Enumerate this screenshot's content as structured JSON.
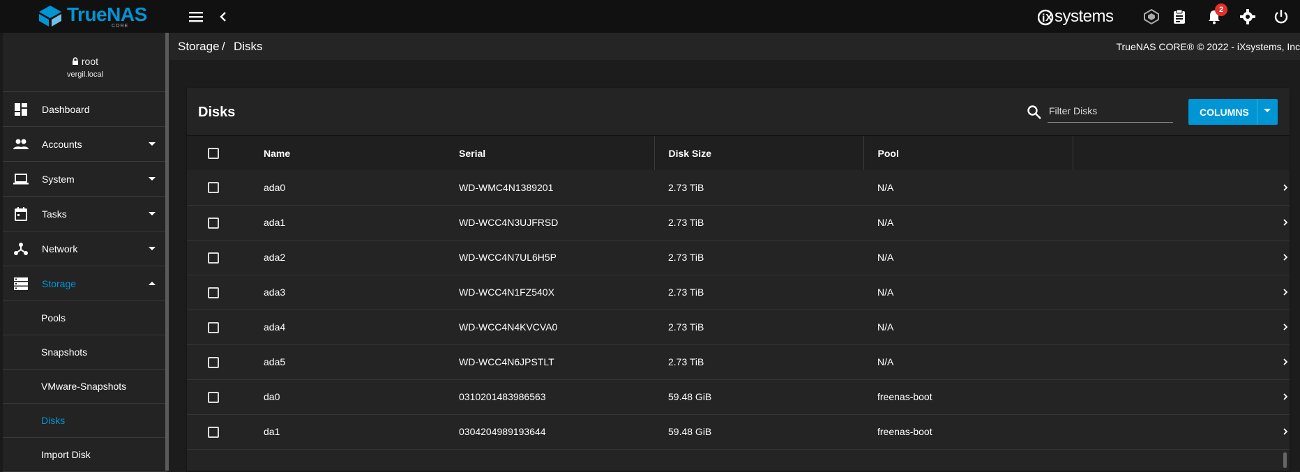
{
  "app": {
    "logo_name": "TrueNAS",
    "logo_sub": "CORE",
    "vendor": "systems",
    "notification_count": "2"
  },
  "user": {
    "name": "root",
    "host": "vergil.local"
  },
  "sidebar": {
    "items": [
      {
        "label": "Dashboard"
      },
      {
        "label": "Accounts"
      },
      {
        "label": "System"
      },
      {
        "label": "Tasks"
      },
      {
        "label": "Network"
      },
      {
        "label": "Storage"
      }
    ],
    "storage_sub": [
      {
        "label": "Pools"
      },
      {
        "label": "Snapshots"
      },
      {
        "label": "VMware-Snapshots"
      },
      {
        "label": "Disks"
      },
      {
        "label": "Import Disk"
      }
    ]
  },
  "breadcrumb": {
    "parent": "Storage",
    "separator": "/",
    "current": "Disks"
  },
  "copyright": "TrueNAS CORE® © 2022 - iXsystems, Inc.",
  "card": {
    "title": "Disks",
    "filter_placeholder": "Filter Disks",
    "columns_label": "COLUMNS"
  },
  "table": {
    "headers": [
      "Name",
      "Serial",
      "Disk Size",
      "Pool"
    ],
    "rows": [
      {
        "name": "ada0",
        "serial": "WD-WMC4N1389201",
        "size": "2.73 TiB",
        "pool": "N/A"
      },
      {
        "name": "ada1",
        "serial": "WD-WCC4N3UJFRSD",
        "size": "2.73 TiB",
        "pool": "N/A"
      },
      {
        "name": "ada2",
        "serial": "WD-WCC4N7UL6H5P",
        "size": "2.73 TiB",
        "pool": "N/A"
      },
      {
        "name": "ada3",
        "serial": "WD-WCC4N1FZ540X",
        "size": "2.73 TiB",
        "pool": "N/A"
      },
      {
        "name": "ada4",
        "serial": "WD-WCC4N4KVCVA0",
        "size": "2.73 TiB",
        "pool": "N/A"
      },
      {
        "name": "ada5",
        "serial": "WD-WCC4N6JPSTLT",
        "size": "2.73 TiB",
        "pool": "N/A"
      },
      {
        "name": "da0",
        "serial": "0310201483986563",
        "size": "59.48 GiB",
        "pool": "freenas-boot"
      },
      {
        "name": "da1",
        "serial": "0304204989193644",
        "size": "59.48 GiB",
        "pool": "freenas-boot"
      }
    ]
  },
  "colors": {
    "accent": "#0095d5",
    "badge": "#e4302a"
  }
}
